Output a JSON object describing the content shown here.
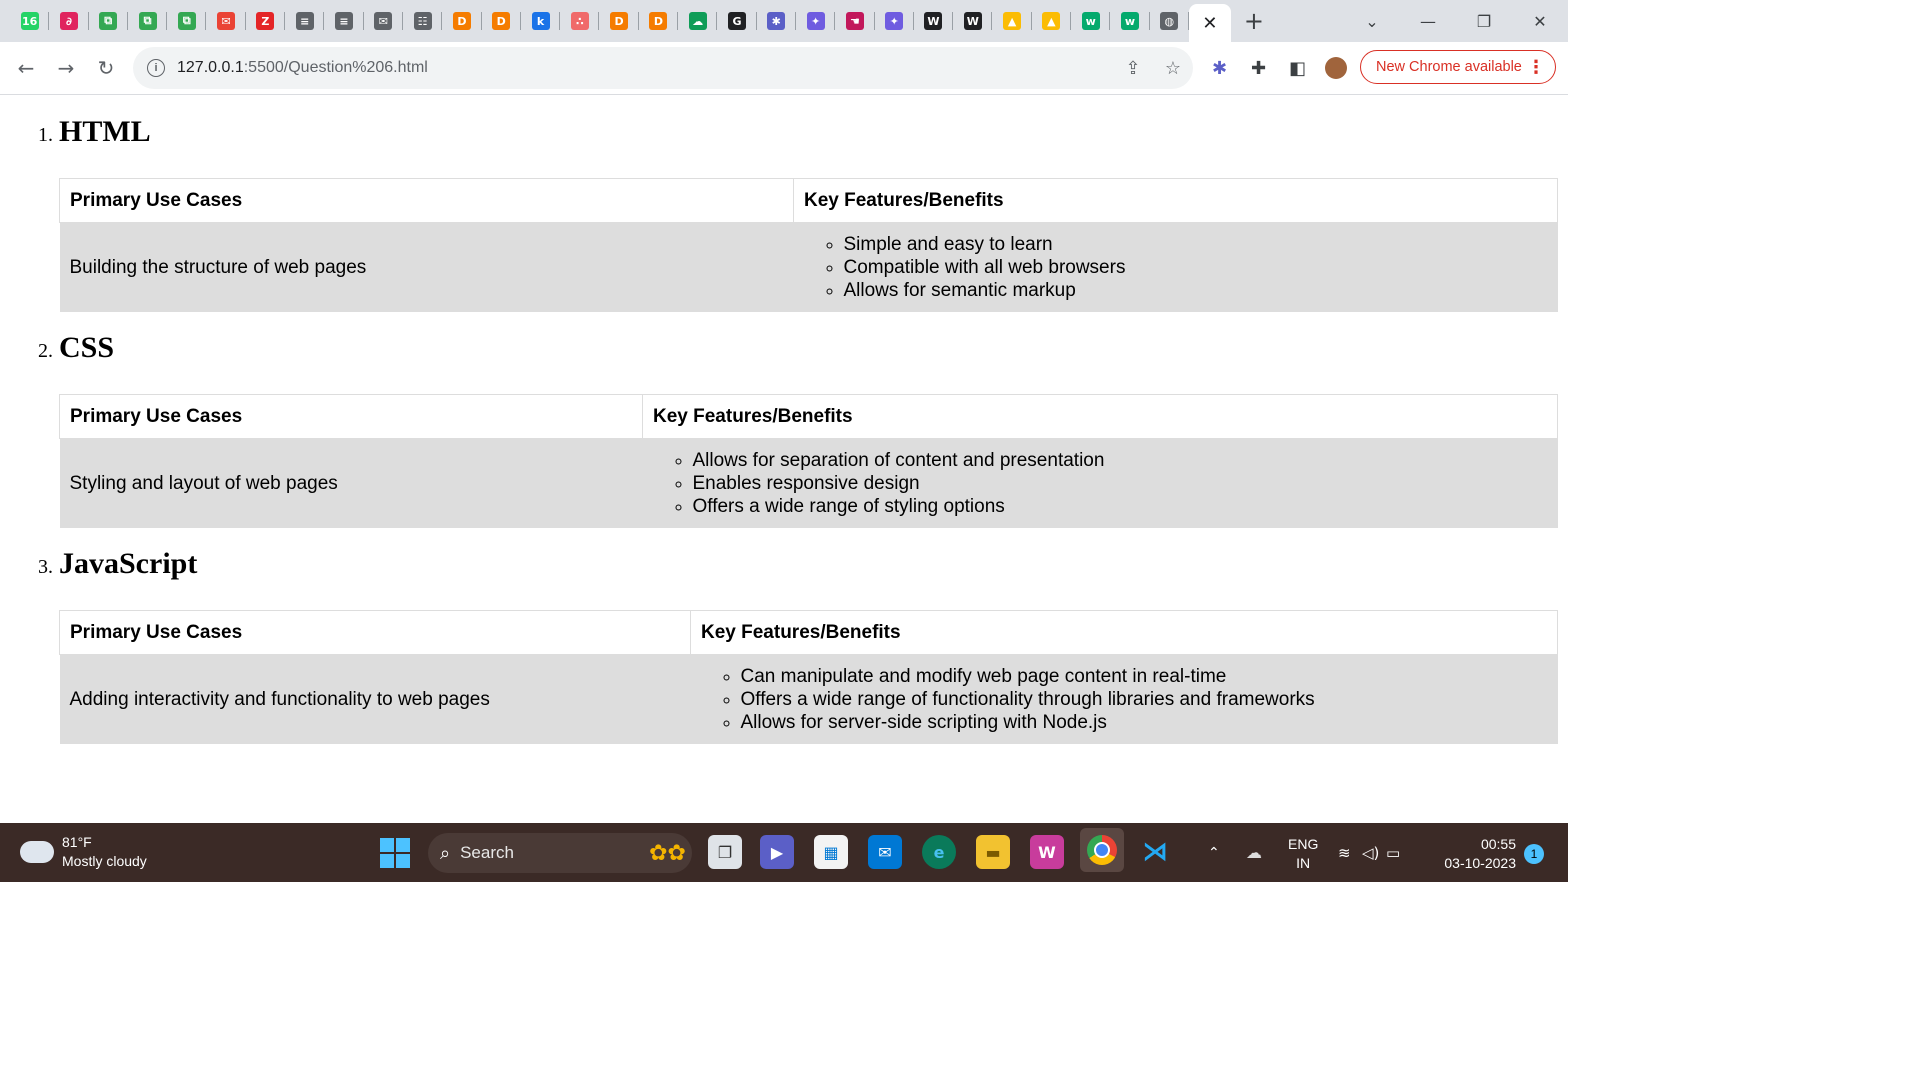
{
  "browser": {
    "tabs": [
      {
        "icon": "whatsapp-icon",
        "glyph": "16",
        "color": "#25d366"
      },
      {
        "icon": "grammar-icon",
        "glyph": "∂",
        "color": "#e0245e"
      },
      {
        "icon": "sheet-icon",
        "glyph": "⧉",
        "color": "#34a853"
      },
      {
        "icon": "sheet-icon",
        "glyph": "⧉",
        "color": "#34a853"
      },
      {
        "icon": "sheet-icon",
        "glyph": "⧉",
        "color": "#34a853"
      },
      {
        "icon": "chat-icon",
        "glyph": "✉",
        "color": "#ea4335"
      },
      {
        "icon": "zoho-icon",
        "glyph": "Z",
        "color": "#e42527"
      },
      {
        "icon": "doc-icon",
        "glyph": "≡",
        "color": "#5f6368"
      },
      {
        "icon": "doc-icon",
        "glyph": "≡",
        "color": "#5f6368"
      },
      {
        "icon": "mail-icon",
        "glyph": "✉",
        "color": "#5f6368"
      },
      {
        "icon": "form-icon",
        "glyph": "☷",
        "color": "#5f6368"
      },
      {
        "icon": "d-icon",
        "glyph": "D",
        "color": "#f57c00"
      },
      {
        "icon": "d-icon",
        "glyph": "D",
        "color": "#f57c00"
      },
      {
        "icon": "k-icon",
        "glyph": "k",
        "color": "#1a73e8"
      },
      {
        "icon": "asana-icon",
        "glyph": "∴",
        "color": "#f06a6a"
      },
      {
        "icon": "d-icon",
        "glyph": "D",
        "color": "#f57c00"
      },
      {
        "icon": "d-icon",
        "glyph": "D",
        "color": "#f57c00"
      },
      {
        "icon": "cloud-up-icon",
        "glyph": "☁",
        "color": "#0f9d58"
      },
      {
        "icon": "g-icon",
        "glyph": "G",
        "color": "#202124"
      },
      {
        "icon": "spark-icon",
        "glyph": "✱",
        "color": "#5b5fc7"
      },
      {
        "icon": "gemini-icon",
        "glyph": "✦",
        "color": "#6f5ce0"
      },
      {
        "icon": "hand-icon",
        "glyph": "☚",
        "color": "#c2185b"
      },
      {
        "icon": "gemini-icon",
        "glyph": "✦",
        "color": "#6f5ce0"
      },
      {
        "icon": "wordpress-icon",
        "glyph": "W",
        "color": "#202124"
      },
      {
        "icon": "wordpress-icon",
        "glyph": "W",
        "color": "#202124"
      },
      {
        "icon": "drive-icon",
        "glyph": "▲",
        "color": "#fbbc04"
      },
      {
        "icon": "drive-icon",
        "glyph": "▲",
        "color": "#fbbc04"
      },
      {
        "icon": "w3schools-icon",
        "glyph": "w",
        "color": "#04aa6d"
      },
      {
        "icon": "w3schools-icon",
        "glyph": "w",
        "color": "#04aa6d"
      },
      {
        "icon": "globe-icon",
        "glyph": "◍",
        "color": "#5f6368"
      }
    ],
    "active_tab_close": "✕",
    "new_tab": "+",
    "url_host": "127.0.0.1",
    "url_rest": ":5500/Question%206.html",
    "update_label": "New Chrome available"
  },
  "page": {
    "sections": [
      {
        "number": "1.",
        "title": "HTML",
        "col1_header": "Primary Use Cases",
        "col2_header": "Key Features/Benefits",
        "use_case": "Building the structure of web pages",
        "features": [
          "Simple and easy to learn",
          "Compatible with all web browsers",
          "Allows for semantic markup"
        ]
      },
      {
        "number": "2.",
        "title": "CSS",
        "col1_header": "Primary Use Cases",
        "col2_header": "Key Features/Benefits",
        "use_case": "Styling and layout of web pages",
        "features": [
          "Allows for separation of content and presentation",
          "Enables responsive design",
          "Offers a wide range of styling options"
        ]
      },
      {
        "number": "3.",
        "title": "JavaScript",
        "col1_header": "Primary Use Cases",
        "col2_header": "Key Features/Benefits",
        "use_case": "Adding interactivity and functionality to web pages",
        "features": [
          "Can manipulate and modify web page content in real-time",
          "Offers a wide range of functionality through libraries and frameworks",
          "Allows for server-side scripting with Node.js"
        ]
      }
    ]
  },
  "taskbar": {
    "weather_temp": "81°F",
    "weather_desc": "Mostly cloudy",
    "search_label": "Search",
    "lang_1": "ENG",
    "lang_2": "IN",
    "time": "00:55",
    "date": "03-10-2023",
    "notifications": "1"
  }
}
